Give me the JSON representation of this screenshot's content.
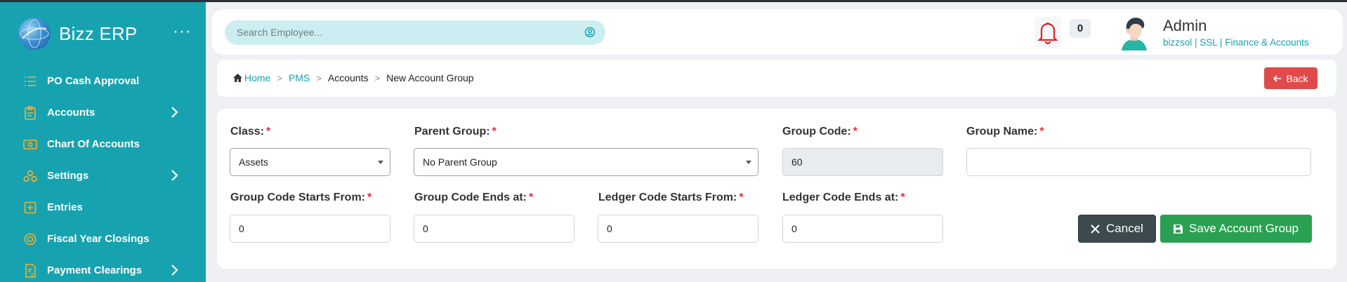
{
  "app": {
    "name": "Bizz ERP",
    "more_glyph": "···"
  },
  "sidebar": {
    "items": [
      {
        "label": "PO Cash Approval",
        "icon": "list-check-icon",
        "has_submenu": false
      },
      {
        "label": "Accounts",
        "icon": "clipboard-icon",
        "has_submenu": true
      },
      {
        "label": "Chart Of Accounts",
        "icon": "money-bill-icon",
        "has_submenu": false
      },
      {
        "label": "Settings",
        "icon": "settings-cluster-icon",
        "has_submenu": true
      },
      {
        "label": "Entries",
        "icon": "plus-square-icon",
        "has_submenu": false
      },
      {
        "label": "Fiscal Year Closings",
        "icon": "coin-icon",
        "has_submenu": false
      },
      {
        "label": "Payment Clearings",
        "icon": "receipt-dollar-icon",
        "has_submenu": true
      }
    ]
  },
  "header": {
    "search_placeholder": "Search Employee...",
    "notification_count": "0",
    "user_name": "Admin",
    "user_org": "bizzsol | SSL  | Finance & Accounts"
  },
  "breadcrumb": {
    "home": "Home",
    "items": [
      "PMS",
      "Accounts",
      "New Account Group"
    ],
    "back_label": "Back"
  },
  "form": {
    "class": {
      "label": "Class:",
      "value": "Assets"
    },
    "parent_group": {
      "label": "Parent Group:",
      "value": "No Parent Group"
    },
    "group_code": {
      "label": "Group Code:",
      "value": "60"
    },
    "group_name": {
      "label": "Group Name:",
      "value": ""
    },
    "group_code_starts_from": {
      "label": "Group Code Starts From:",
      "value": "0"
    },
    "group_code_ends_at": {
      "label": "Group Code Ends at:",
      "value": "0"
    },
    "ledger_code_starts_from": {
      "label": "Ledger Code Starts From:",
      "value": "0"
    },
    "ledger_code_ends_at": {
      "label": "Ledger Code Ends at:",
      "value": "0"
    },
    "required_mark": "*",
    "cancel_label": "Cancel",
    "save_label": "Save Account Group"
  },
  "colors": {
    "sidebar_bg": "#17a2b0",
    "icon_accent": "#f2b233",
    "save_green": "#2aa152",
    "back_red": "#e04a4a",
    "required_red": "#e0303a"
  }
}
